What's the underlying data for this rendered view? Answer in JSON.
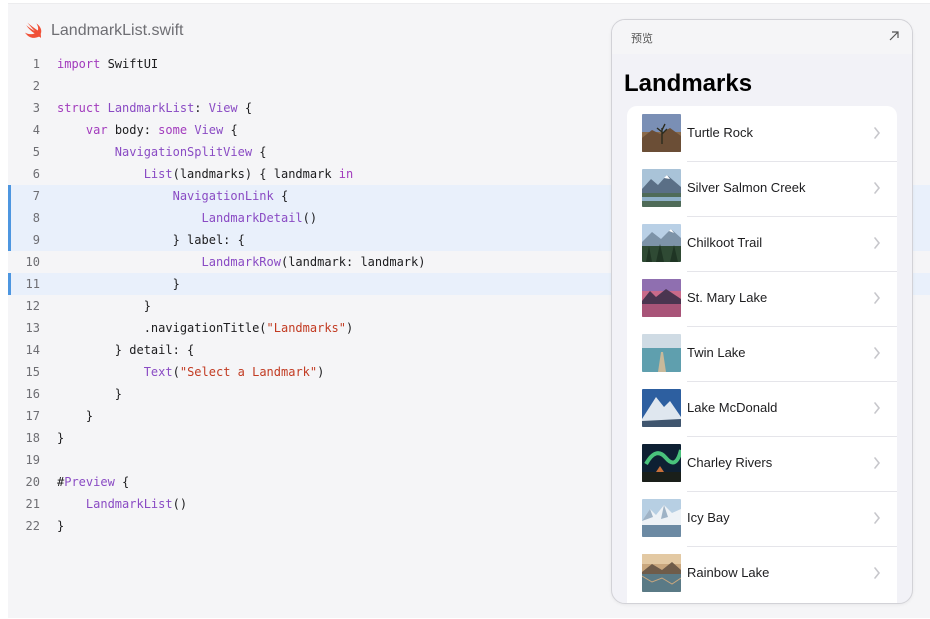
{
  "editor": {
    "file_name": "LandmarkList.swift",
    "lines": [
      {
        "n": "1",
        "text": "import SwiftUI"
      },
      {
        "n": "2",
        "text": ""
      },
      {
        "n": "3",
        "text": "struct LandmarkList: View {"
      },
      {
        "n": "4",
        "text": "    var body: some View {"
      },
      {
        "n": "5",
        "text": "        NavigationSplitView {"
      },
      {
        "n": "6",
        "text": "            List(landmarks) { landmark in"
      },
      {
        "n": "7",
        "text": "                NavigationLink {"
      },
      {
        "n": "8",
        "text": "                    LandmarkDetail()"
      },
      {
        "n": "9",
        "text": "                } label: {"
      },
      {
        "n": "10",
        "text": "                    LandmarkRow(landmark: landmark)"
      },
      {
        "n": "11",
        "text": "                }"
      },
      {
        "n": "12",
        "text": "            }"
      },
      {
        "n": "13",
        "text": "            .navigationTitle(\"Landmarks\")"
      },
      {
        "n": "14",
        "text": "        } detail: {"
      },
      {
        "n": "15",
        "text": "            Text(\"Select a Landmark\")"
      },
      {
        "n": "16",
        "text": "        }"
      },
      {
        "n": "17",
        "text": "    }"
      },
      {
        "n": "18",
        "text": "}"
      },
      {
        "n": "19",
        "text": ""
      },
      {
        "n": "20",
        "text": "#Preview {"
      },
      {
        "n": "21",
        "text": "    LandmarkList()"
      },
      {
        "n": "22",
        "text": "}"
      }
    ],
    "highlighted_lines": [
      "7",
      "8",
      "9",
      "11"
    ]
  },
  "preview": {
    "label": "预览",
    "expand_icon": "arrow-up-right-icon",
    "nav_title": "Landmarks",
    "rows": [
      {
        "name": "Turtle Rock",
        "thumb": "desert"
      },
      {
        "name": "Silver Salmon Creek",
        "thumb": "mountain-water"
      },
      {
        "name": "Chilkoot Trail",
        "thumb": "forest-mountain"
      },
      {
        "name": "St. Mary Lake",
        "thumb": "sunset-lake"
      },
      {
        "name": "Twin Lake",
        "thumb": "lake-dock"
      },
      {
        "name": "Lake McDonald",
        "thumb": "snow-mountain"
      },
      {
        "name": "Charley Rivers",
        "thumb": "aurora"
      },
      {
        "name": "Icy Bay",
        "thumb": "icy-bay"
      },
      {
        "name": "Rainbow Lake",
        "thumb": "rainbow-lake"
      }
    ]
  },
  "colors": {
    "keyword": "#a23bbd",
    "type": "#8a4bc4",
    "string": "#c23b22",
    "highlight_bar": "#4d96e0",
    "swift_orange": "#f05138"
  }
}
